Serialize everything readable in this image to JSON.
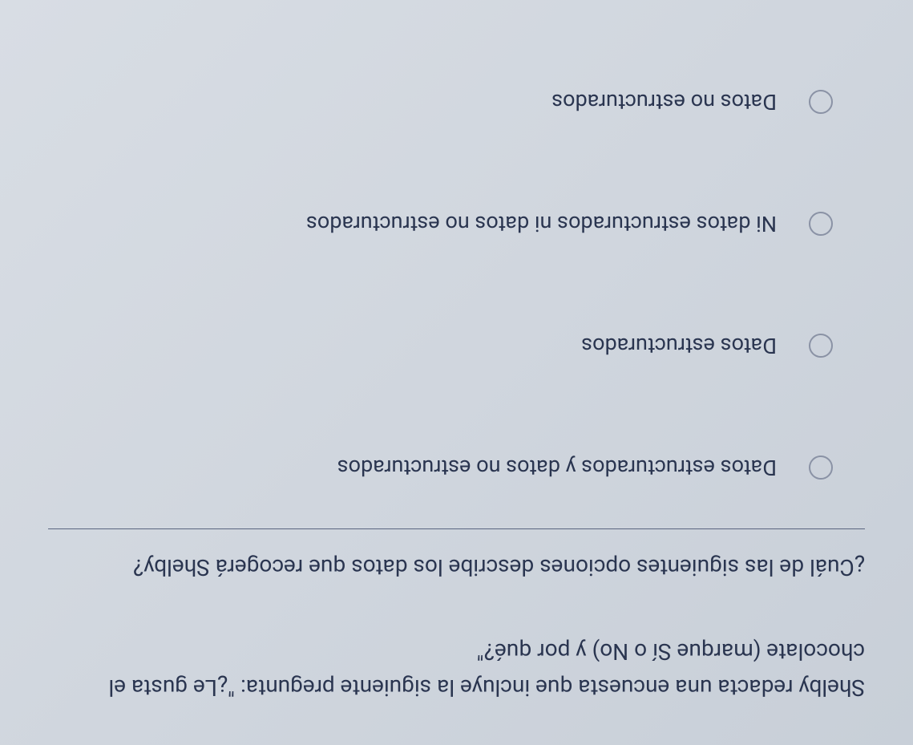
{
  "context": "Shelby redacta una encuesta que incluye la siguiente pregunta: \"¿Le gusta el chocolate (marque Sí o No) y por qué?\"",
  "question": "¿Cuál de las siguientes opciones describe los datos que recogerá Shelby?",
  "options": [
    {
      "label": "Datos estructurados y datos no estructurados"
    },
    {
      "label": "Datos estructurados"
    },
    {
      "label": "Ni datos estructurados ni datos no estructurados"
    },
    {
      "label": "Datos no estructurados"
    }
  ]
}
